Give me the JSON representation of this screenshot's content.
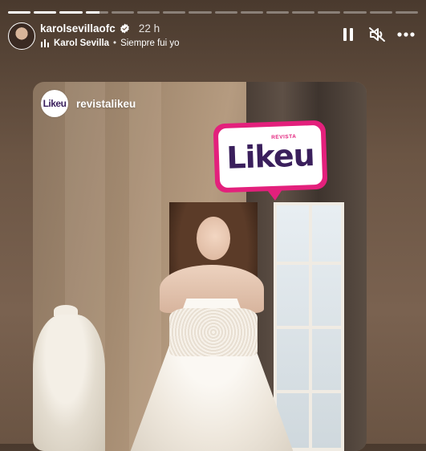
{
  "story": {
    "username": "karolsevillaofc",
    "time_ago": "22 h",
    "music": {
      "artist": "Karol Sevilla",
      "separator": "•",
      "song": "Siempre fui yo"
    },
    "progress_segments": {
      "total": 16,
      "completed": 3,
      "current_fraction": 0.6
    },
    "controls": {
      "pause_icon": "pause-icon",
      "mute_icon": "muted-speaker-icon",
      "more_icon": "more-horizontal-icon"
    }
  },
  "repost": {
    "account_name": "revistalikeu",
    "avatar_logo_text": "Likeu"
  },
  "sticker": {
    "word": "Likeu",
    "small_text": "REVISTA"
  },
  "colors": {
    "brand_pink": "#e3207c",
    "brand_purple": "#3a1f5c"
  }
}
